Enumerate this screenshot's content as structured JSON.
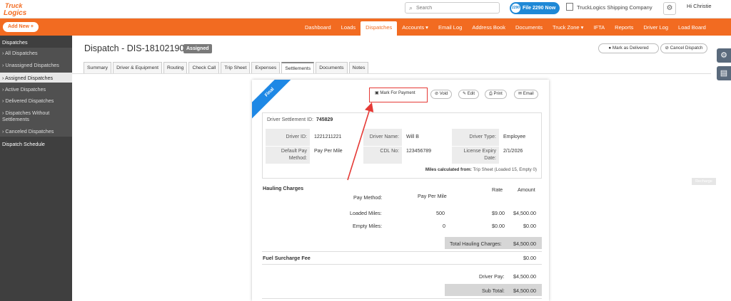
{
  "brand": {
    "logo_line1": "Truck",
    "logo_line2": "Logics",
    "accent": "#f26b21"
  },
  "topbar": {
    "search_placeholder": "Search",
    "search_icon": "search-icon",
    "file2290_badge": "2290",
    "file2290_label": "File 2290 Now",
    "company": "TruckLogics Shipping Company",
    "greeting": "Hi Christie"
  },
  "navbar": {
    "add_new": "Add New",
    "links": [
      "Dashboard",
      "Loads",
      "Dispatches",
      "Accounts ▾",
      "Email Log",
      "Address Book",
      "Documents",
      "Truck Zone ▾",
      "IFTA",
      "Reports",
      "Driver Log",
      "Load Board"
    ],
    "active_index": 2
  },
  "sidebar": {
    "section": "Dispatches",
    "items": [
      "All Dispatches",
      "Unassigned Dispatches",
      "Assigned Dispatches",
      "Active Dispatches",
      "Delivered Dispatches",
      "Dispatches Without Settlements",
      "Canceled Dispatches"
    ],
    "active_index": 2,
    "schedule": "Dispatch Schedule"
  },
  "page": {
    "title": "Dispatch - DIS-18102190",
    "status": "Assigned",
    "mark_delivered": "Mark as Delivered",
    "cancel_dispatch": "Cancel Dispatch"
  },
  "tabs": [
    "Summary",
    "Driver & Equipment",
    "Routing",
    "Check Call",
    "Trip Sheet",
    "Expenses",
    "Settlements",
    "Documents",
    "Notes"
  ],
  "tabs_active_index": 6,
  "settlement": {
    "ribbon": "Final",
    "actions": {
      "mark_for_payment": "Mark For Payment",
      "void": "Void",
      "edit": "Edit",
      "print": "Print",
      "email": "Email"
    },
    "id_label": "Driver Settlement ID:",
    "id_value": "745829",
    "driver_id_label": "Driver ID:",
    "driver_id": "1221211221",
    "driver_name_label": "Driver Name:",
    "driver_name": "Will B",
    "driver_type_label": "Driver Type:",
    "driver_type": "Employee",
    "pay_method_label_1": "Default Pay",
    "pay_method_label_2": "Method:",
    "pay_method": "Pay Per Mile",
    "cdl_label": "CDL No:",
    "cdl": "123456789",
    "license_label_1": "License Expiry",
    "license_label_2": "Date:",
    "license_expiry": "2/1/2026",
    "miles_label": "Miles calculated from:",
    "miles_value": "Trip Sheet (Loaded 15, Empty 0)",
    "hauling": {
      "title": "Hauling Charges",
      "rate_header": "Rate",
      "amount_header": "Amount",
      "pay_method_label": "Pay Method:",
      "pay_method_value": "Pay Per Mile",
      "loaded_label": "Loaded Miles:",
      "loaded_miles": "500",
      "loaded_rate": "$9.00",
      "loaded_amount": "$4,500.00",
      "empty_label": "Empty Miles:",
      "empty_miles": "0",
      "empty_rate": "$0.00",
      "empty_amount": "$0.00",
      "total_label": "Total Hauling Charges:",
      "total": "$4,500.00"
    },
    "fuel_label": "Fuel Surcharge Fee",
    "fuel_amount": "$0.00",
    "driver_pay_label": "Driver Pay:",
    "driver_pay": "$4,500.00",
    "subtotal_label": "Sub Total:",
    "subtotal": "$4,500.00"
  },
  "recharge": "Recharge"
}
